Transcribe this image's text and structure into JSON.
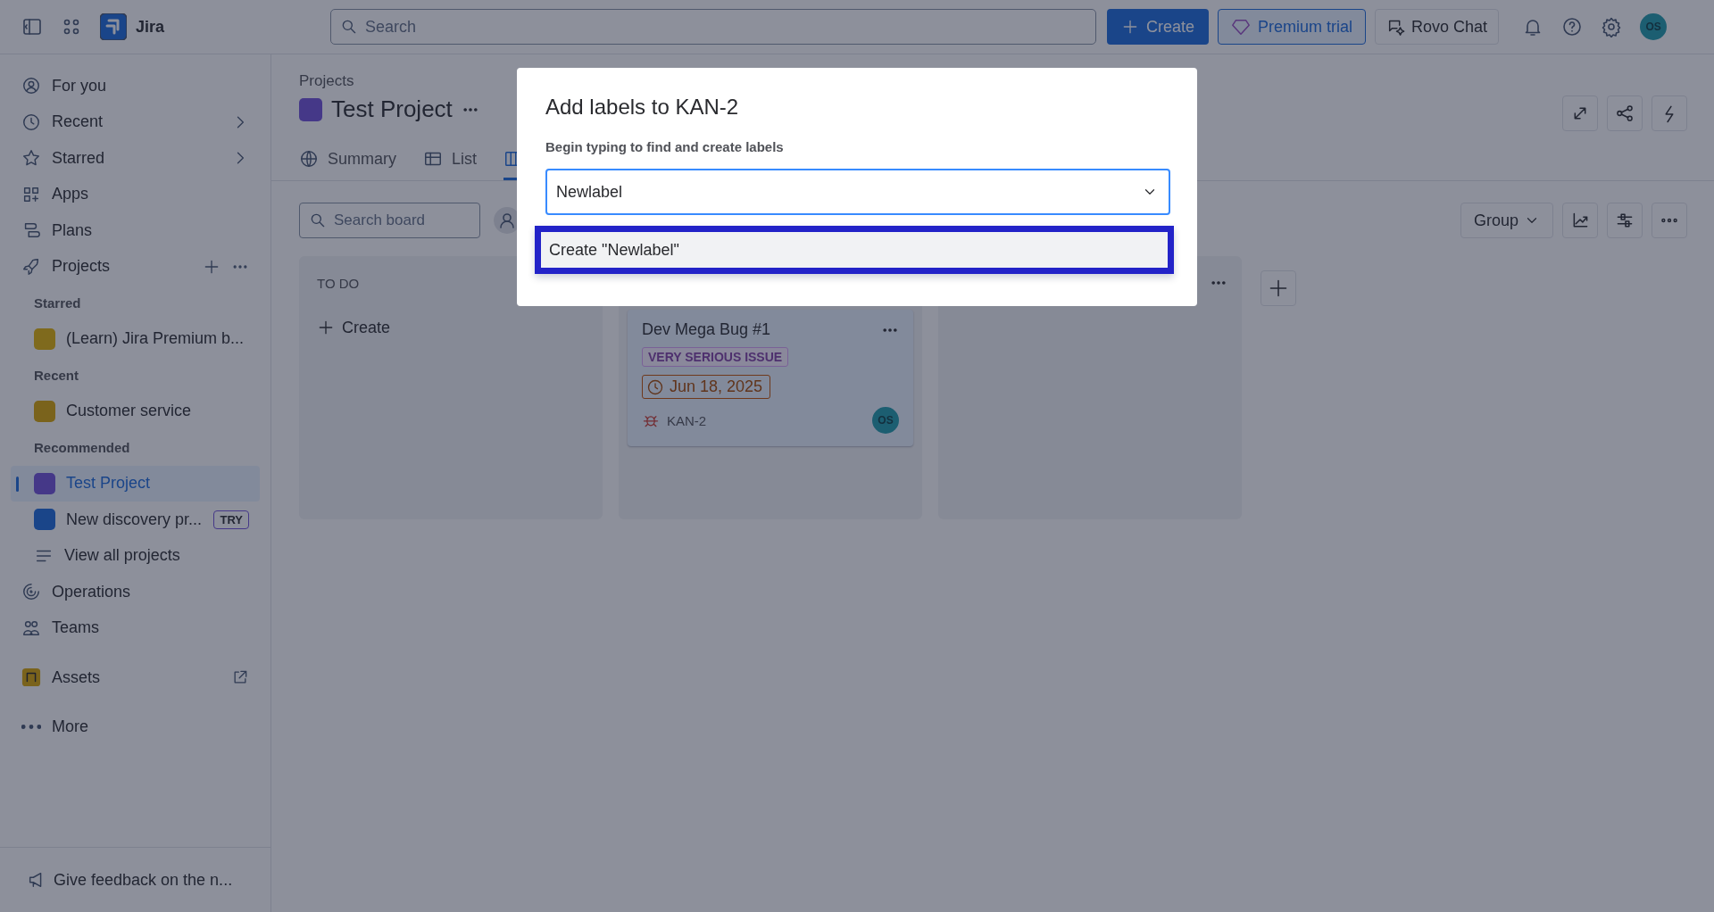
{
  "topbar": {
    "product": "Jira",
    "search": {
      "placeholder": "Search"
    },
    "create": "Create",
    "premium": "Premium trial",
    "rovo": "Rovo Chat",
    "avatar": "OS"
  },
  "sidebar": {
    "items": [
      {
        "kind": "nav",
        "label": "For you"
      },
      {
        "kind": "nav",
        "label": "Recent",
        "chevron": true
      },
      {
        "kind": "nav",
        "label": "Starred",
        "chevron": true
      },
      {
        "kind": "nav",
        "label": "Apps"
      },
      {
        "kind": "nav",
        "label": "Plans"
      },
      {
        "kind": "nav",
        "label": "Projects",
        "actions": true
      },
      {
        "kind": "heading",
        "label": "Starred"
      },
      {
        "kind": "project",
        "label": "(Learn) Jira Premium b...",
        "selected": false
      },
      {
        "kind": "heading",
        "label": "Recent"
      },
      {
        "kind": "project",
        "label": "Customer service",
        "selected": false
      },
      {
        "kind": "heading",
        "label": "Recommended"
      },
      {
        "kind": "project",
        "label": "Test Project",
        "selected": true
      },
      {
        "kind": "project",
        "label": "New discovery pr...",
        "selected": false,
        "badge": "TRY"
      },
      {
        "kind": "sub",
        "label": "View all projects"
      },
      {
        "kind": "nav",
        "label": "Operations"
      },
      {
        "kind": "nav",
        "label": "Teams"
      },
      {
        "kind": "app",
        "label": "Assets",
        "external": true
      },
      {
        "kind": "more",
        "label": "More"
      }
    ],
    "footer": "Give feedback on the n..."
  },
  "header": {
    "breadcrumb": "Projects",
    "title": "Test Project",
    "tabs": [
      {
        "label": "Summary",
        "selected": false
      },
      {
        "label": "List",
        "selected": false
      },
      {
        "selected": true
      }
    ]
  },
  "toolbar": {
    "search": {
      "placeholder": "Search board"
    },
    "group": "Group"
  },
  "columns": [
    {
      "title": "TO DO",
      "create": "Create"
    },
    {
      "cards": [
        {
          "title": "Dev Mega Bug #1",
          "label": "VERY SERIOUS ISSUE",
          "due": "Jun 18, 2025",
          "key": "KAN-2",
          "assignee": "OS"
        }
      ]
    },
    {}
  ],
  "dialog": {
    "title": "Add labels to KAN-2",
    "hint": "Begin typing to find and create labels",
    "value": "Newlabel",
    "options": [
      {
        "label": "Create \"Newlabel\"",
        "selected": true
      }
    ]
  }
}
